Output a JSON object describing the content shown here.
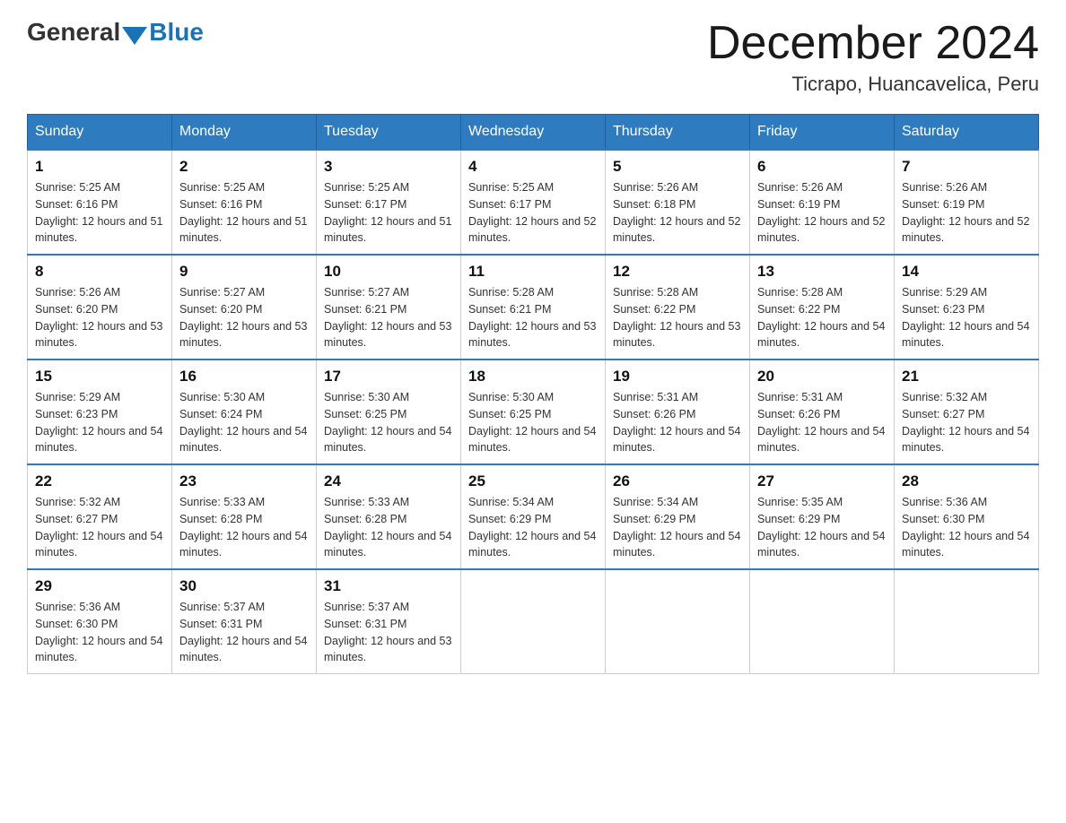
{
  "logo": {
    "general": "General",
    "blue": "Blue"
  },
  "title": {
    "month": "December 2024",
    "location": "Ticrapo, Huancavelica, Peru"
  },
  "headers": [
    "Sunday",
    "Monday",
    "Tuesday",
    "Wednesday",
    "Thursday",
    "Friday",
    "Saturday"
  ],
  "weeks": [
    [
      {
        "day": "1",
        "sunrise": "5:25 AM",
        "sunset": "6:16 PM",
        "daylight": "12 hours and 51 minutes."
      },
      {
        "day": "2",
        "sunrise": "5:25 AM",
        "sunset": "6:16 PM",
        "daylight": "12 hours and 51 minutes."
      },
      {
        "day": "3",
        "sunrise": "5:25 AM",
        "sunset": "6:17 PM",
        "daylight": "12 hours and 51 minutes."
      },
      {
        "day": "4",
        "sunrise": "5:25 AM",
        "sunset": "6:17 PM",
        "daylight": "12 hours and 52 minutes."
      },
      {
        "day": "5",
        "sunrise": "5:26 AM",
        "sunset": "6:18 PM",
        "daylight": "12 hours and 52 minutes."
      },
      {
        "day": "6",
        "sunrise": "5:26 AM",
        "sunset": "6:19 PM",
        "daylight": "12 hours and 52 minutes."
      },
      {
        "day": "7",
        "sunrise": "5:26 AM",
        "sunset": "6:19 PM",
        "daylight": "12 hours and 52 minutes."
      }
    ],
    [
      {
        "day": "8",
        "sunrise": "5:26 AM",
        "sunset": "6:20 PM",
        "daylight": "12 hours and 53 minutes."
      },
      {
        "day": "9",
        "sunrise": "5:27 AM",
        "sunset": "6:20 PM",
        "daylight": "12 hours and 53 minutes."
      },
      {
        "day": "10",
        "sunrise": "5:27 AM",
        "sunset": "6:21 PM",
        "daylight": "12 hours and 53 minutes."
      },
      {
        "day": "11",
        "sunrise": "5:28 AM",
        "sunset": "6:21 PM",
        "daylight": "12 hours and 53 minutes."
      },
      {
        "day": "12",
        "sunrise": "5:28 AM",
        "sunset": "6:22 PM",
        "daylight": "12 hours and 53 minutes."
      },
      {
        "day": "13",
        "sunrise": "5:28 AM",
        "sunset": "6:22 PM",
        "daylight": "12 hours and 54 minutes."
      },
      {
        "day": "14",
        "sunrise": "5:29 AM",
        "sunset": "6:23 PM",
        "daylight": "12 hours and 54 minutes."
      }
    ],
    [
      {
        "day": "15",
        "sunrise": "5:29 AM",
        "sunset": "6:23 PM",
        "daylight": "12 hours and 54 minutes."
      },
      {
        "day": "16",
        "sunrise": "5:30 AM",
        "sunset": "6:24 PM",
        "daylight": "12 hours and 54 minutes."
      },
      {
        "day": "17",
        "sunrise": "5:30 AM",
        "sunset": "6:25 PM",
        "daylight": "12 hours and 54 minutes."
      },
      {
        "day": "18",
        "sunrise": "5:30 AM",
        "sunset": "6:25 PM",
        "daylight": "12 hours and 54 minutes."
      },
      {
        "day": "19",
        "sunrise": "5:31 AM",
        "sunset": "6:26 PM",
        "daylight": "12 hours and 54 minutes."
      },
      {
        "day": "20",
        "sunrise": "5:31 AM",
        "sunset": "6:26 PM",
        "daylight": "12 hours and 54 minutes."
      },
      {
        "day": "21",
        "sunrise": "5:32 AM",
        "sunset": "6:27 PM",
        "daylight": "12 hours and 54 minutes."
      }
    ],
    [
      {
        "day": "22",
        "sunrise": "5:32 AM",
        "sunset": "6:27 PM",
        "daylight": "12 hours and 54 minutes."
      },
      {
        "day": "23",
        "sunrise": "5:33 AM",
        "sunset": "6:28 PM",
        "daylight": "12 hours and 54 minutes."
      },
      {
        "day": "24",
        "sunrise": "5:33 AM",
        "sunset": "6:28 PM",
        "daylight": "12 hours and 54 minutes."
      },
      {
        "day": "25",
        "sunrise": "5:34 AM",
        "sunset": "6:29 PM",
        "daylight": "12 hours and 54 minutes."
      },
      {
        "day": "26",
        "sunrise": "5:34 AM",
        "sunset": "6:29 PM",
        "daylight": "12 hours and 54 minutes."
      },
      {
        "day": "27",
        "sunrise": "5:35 AM",
        "sunset": "6:29 PM",
        "daylight": "12 hours and 54 minutes."
      },
      {
        "day": "28",
        "sunrise": "5:36 AM",
        "sunset": "6:30 PM",
        "daylight": "12 hours and 54 minutes."
      }
    ],
    [
      {
        "day": "29",
        "sunrise": "5:36 AM",
        "sunset": "6:30 PM",
        "daylight": "12 hours and 54 minutes."
      },
      {
        "day": "30",
        "sunrise": "5:37 AM",
        "sunset": "6:31 PM",
        "daylight": "12 hours and 54 minutes."
      },
      {
        "day": "31",
        "sunrise": "5:37 AM",
        "sunset": "6:31 PM",
        "daylight": "12 hours and 53 minutes."
      },
      null,
      null,
      null,
      null
    ]
  ]
}
